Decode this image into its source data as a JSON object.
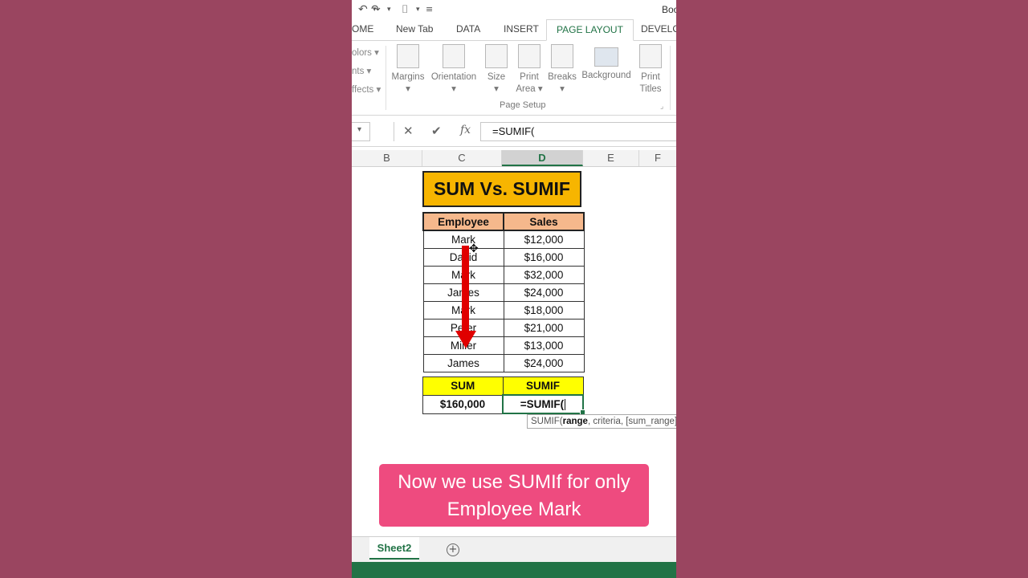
{
  "window": {
    "title": "Boo"
  },
  "ribbon_tabs": [
    {
      "label": "OME"
    },
    {
      "label": "New Tab"
    },
    {
      "label": "DATA"
    },
    {
      "label": "INSERT"
    },
    {
      "label": "PAGE LAYOUT",
      "active": true
    },
    {
      "label": "DEVELO"
    }
  ],
  "ribbon": {
    "theme_items": [
      "olors",
      "nts",
      "ffects"
    ],
    "buttons": [
      {
        "label": "Margins",
        "label2": "",
        "icon": "margins-icon"
      },
      {
        "label": "Orientation",
        "label2": "",
        "icon": "orientation-icon"
      },
      {
        "label": "Size",
        "label2": "",
        "icon": "size-icon"
      },
      {
        "label": "Print",
        "label2": "Area",
        "icon": "print-area-icon"
      },
      {
        "label": "Breaks",
        "label2": "",
        "icon": "breaks-icon"
      },
      {
        "label": "Background",
        "label2": "",
        "icon": "background-icon"
      },
      {
        "label": "Print",
        "label2": "Titles",
        "icon": "print-titles-icon"
      }
    ],
    "group_label": "Page Setup"
  },
  "formula_bar": {
    "formula": "=SUMIF("
  },
  "columns": [
    "B",
    "C",
    "D",
    "E",
    "F"
  ],
  "selected_column": "D",
  "sheet": {
    "title": "SUM Vs. SUMIF",
    "headers": [
      "Employee",
      "Sales"
    ],
    "rows": [
      [
        "Mark",
        "$12,000"
      ],
      [
        "David",
        "$16,000"
      ],
      [
        "Mark",
        "$32,000"
      ],
      [
        "James",
        "$24,000"
      ],
      [
        "Mark",
        "$18,000"
      ],
      [
        "Peter",
        "$21,000"
      ],
      [
        "Miller",
        "$13,000"
      ],
      [
        "James",
        "$24,000"
      ]
    ],
    "summary_headers": [
      "SUM",
      "SUMIF"
    ],
    "sum_value": "$160,000",
    "sumif_value": "=SUMIF(",
    "tooltip": {
      "fn": "SUMIF(",
      "arg1": "range",
      "rest": ", criteria, [sum_range]"
    }
  },
  "callout": {
    "line1": "Now we use SUMIf for only",
    "line2": "Employee Mark"
  },
  "sheet_tab": "Sheet2",
  "colors": {
    "accent": "#217346",
    "title_fill": "#f7b500",
    "header_fill": "#f5b88c",
    "summary_fill": "#ffff00",
    "callout": "#ee4b7f",
    "arrow": "#e00000"
  }
}
